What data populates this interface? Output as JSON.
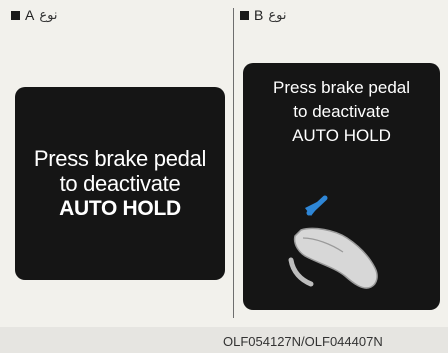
{
  "type_a": {
    "label": "نوع",
    "letter": "A",
    "message_line1": "Press brake pedal",
    "message_line2": "to deactivate",
    "message_line3": "AUTO HOLD"
  },
  "type_b": {
    "label": "نوع",
    "letter": "B",
    "message_line1": "Press brake pedal",
    "message_line2": "to deactivate",
    "message_line3": "AUTO HOLD"
  },
  "footer": {
    "code": "OLF054127N/OLF044407N"
  },
  "colors": {
    "screen_bg": "#151515",
    "arrow": "#2e86d6",
    "page_bg": "#f2f1ec"
  }
}
